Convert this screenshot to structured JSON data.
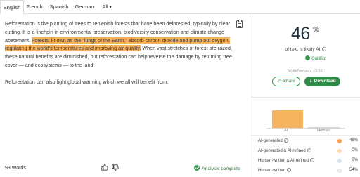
{
  "tabs": [
    {
      "label": "English",
      "active": true
    },
    {
      "label": "French"
    },
    {
      "label": "Spanish"
    },
    {
      "label": "German"
    },
    {
      "label": "All"
    }
  ],
  "text": {
    "p1_before": "Reforestation is the planting of trees to replenish forests that have been deforested, typically by clear cutting. It is a linchpin in environmental preservation, biodiversity conservation and climate change abatement. ",
    "p1_highlight": "Forests, known as the \"lungs of the Earth,\" absorb carbon dioxide and pump out oxygen, regulating the world's temperatures and improving air quality.",
    "p1_after": " When vast stretches of forest are razed, these natural benefits are diminished, but reforestation can help reverse the damage by returning tree cover — and ecosystems — to the land.",
    "p2": "Reforestation can also fight global warming which we all will benefit from."
  },
  "footer": {
    "word_count": "93 Words",
    "status": "Analysis complete"
  },
  "result": {
    "percent": "46",
    "percent_sign": "%",
    "likely_text": "of text is likely AI",
    "info_glyph": "i",
    "brand": "QuillBot",
    "version": "ModelVersion: v3.5.0",
    "share_label": "Share",
    "download_label": "Download"
  },
  "chart_data": {
    "type": "bar",
    "categories": [
      "AI",
      "Human"
    ],
    "values": [
      46,
      0
    ],
    "colors": [
      "#f7b460",
      "#cfd6e2"
    ]
  },
  "breakdown": [
    {
      "label": "AI-generated",
      "value": "46%",
      "color": "#f7a24a"
    },
    {
      "label": "AI-generated & AI-refined",
      "value": "0%",
      "color": "#fbd9ad"
    },
    {
      "label": "Human-written & AI-refined",
      "value": "0%",
      "color": "#d9e4f2"
    },
    {
      "label": "Human-written",
      "value": "54%",
      "color": "#eef1f5"
    }
  ],
  "icons": {
    "copy": "copy-icon",
    "thumbs_up": "thumbs-up-icon",
    "thumbs_down": "thumbs-down-icon",
    "check": "check-circle-icon",
    "share": "share-icon",
    "download": "download-icon",
    "info": "info-icon",
    "brand_logo": "quillbot-logo"
  }
}
